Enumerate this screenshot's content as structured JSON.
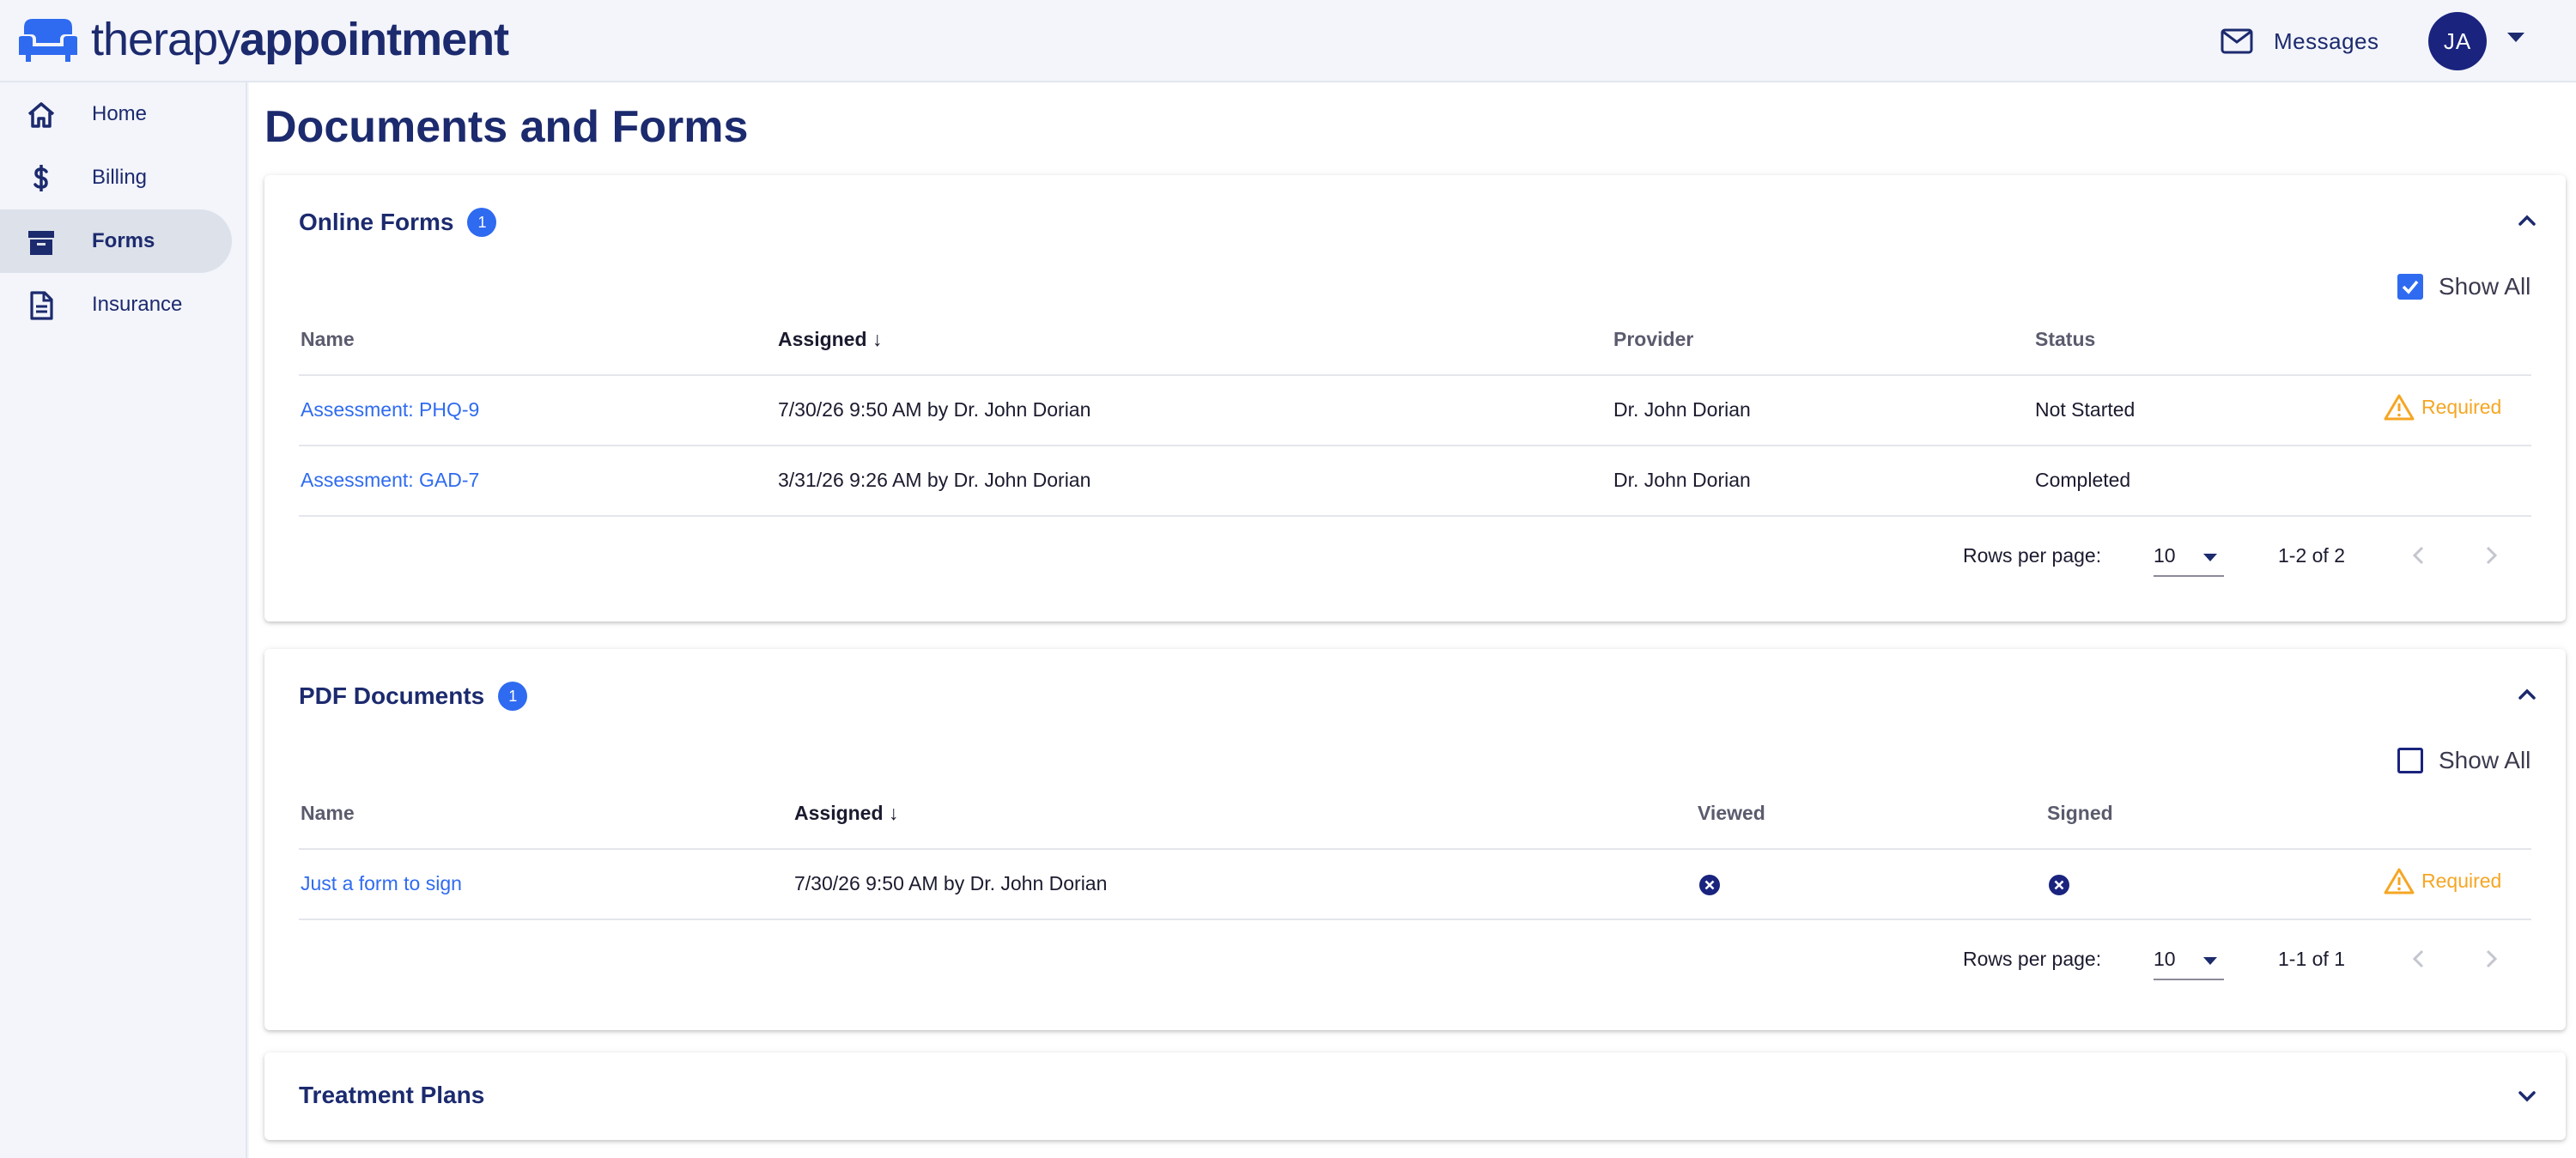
{
  "brand": {
    "light": "therapy",
    "bold": "appointment",
    "color": "#1c2a6e",
    "accent": "#2f6bf0"
  },
  "header": {
    "messages_label": "Messages",
    "avatar_initials": "JA"
  },
  "sidebar": {
    "items": [
      {
        "label": "Home",
        "icon": "home-icon"
      },
      {
        "label": "Billing",
        "icon": "dollar-icon"
      },
      {
        "label": "Forms",
        "icon": "archive-box-icon",
        "active": true
      },
      {
        "label": "Insurance",
        "icon": "document-icon"
      }
    ]
  },
  "page": {
    "title": "Documents and Forms"
  },
  "online_forms": {
    "title": "Online Forms",
    "badge": "1",
    "expanded": true,
    "show_all_label": "Show All",
    "show_all_checked": true,
    "columns": [
      "Name",
      "Assigned",
      "Provider",
      "Status"
    ],
    "rows": [
      {
        "name": "Assessment: PHQ-9",
        "assigned": "7/30/26 9:50 AM by Dr. John Dorian",
        "provider": "Dr. John Dorian",
        "status": "Not Started",
        "flag": "Required"
      },
      {
        "name": "Assessment: GAD-7",
        "assigned": "3/31/26 9:26 AM by Dr. John Dorian",
        "provider": "Dr. John Dorian",
        "status": "Completed",
        "flag": ""
      }
    ],
    "pagination": {
      "rows_per_page_label": "Rows per page:",
      "rows_per_page": "10",
      "range": "1-2 of 2"
    }
  },
  "pdf_documents": {
    "title": "PDF Documents",
    "badge": "1",
    "expanded": true,
    "show_all_label": "Show All",
    "show_all_checked": false,
    "columns": [
      "Name",
      "Assigned",
      "Viewed",
      "Signed"
    ],
    "rows": [
      {
        "name": "Just a form to sign",
        "assigned": "7/30/26 9:50 AM by Dr. John Dorian",
        "viewed": "x-circle-icon",
        "signed": "x-circle-icon",
        "flag": "Required"
      }
    ],
    "pagination": {
      "rows_per_page_label": "Rows per page:",
      "rows_per_page": "10",
      "range": "1-1 of 1"
    }
  },
  "treatment_plans": {
    "title": "Treatment Plans",
    "expanded": false
  },
  "colors": {
    "warning": "#f5a623",
    "link": "#2f6bf0",
    "navy": "#1a237e"
  }
}
